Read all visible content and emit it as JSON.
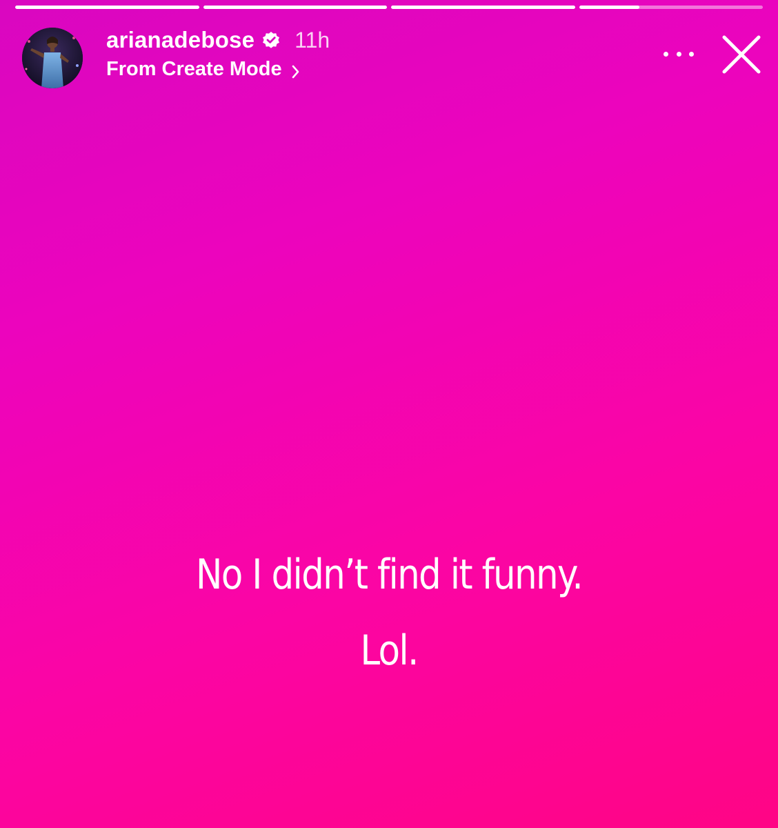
{
  "story": {
    "progress": [
      1,
      1,
      1,
      0.33
    ],
    "background_colors": [
      "#d907c0",
      "#ec04bd",
      "#fb05a4",
      "#ff0585"
    ]
  },
  "header": {
    "username": "arianadebose",
    "time": "11h",
    "subtitle": "From Create Mode",
    "verified_icon": "verified-badge-icon",
    "chevron_icon": "chevron-right-icon",
    "more_icon": "more-horizontal-icon",
    "close_icon": "close-icon"
  },
  "caption": {
    "line1": "No I didn’t find it funny.",
    "line2": "Lol."
  }
}
